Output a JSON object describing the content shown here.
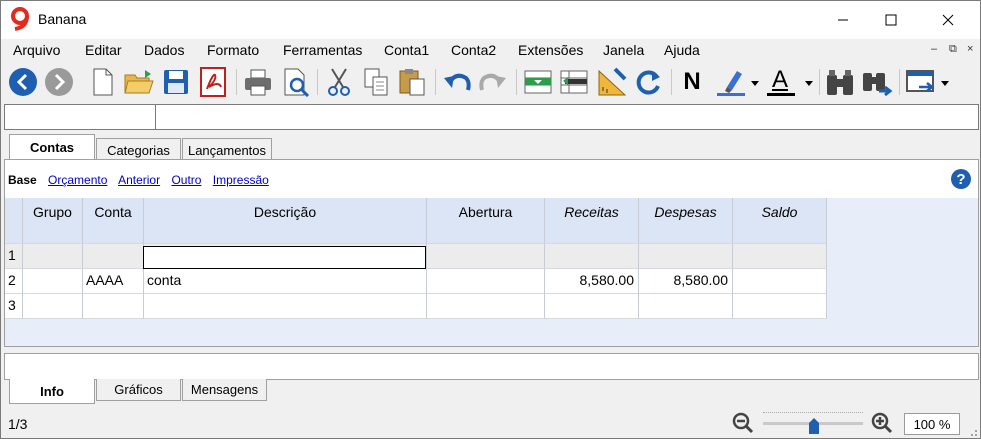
{
  "window": {
    "title": "Banana",
    "logo_glyph": "9",
    "logo_color": "#e32a1c"
  },
  "menu": {
    "items": [
      "Arquivo",
      "Editar",
      "Dados",
      "Formato",
      "Ferramentas",
      "Conta1",
      "Conta2",
      "Extensões",
      "Janela",
      "Ajuda"
    ]
  },
  "toolbar": {
    "icons": [
      "back-icon",
      "forward-icon",
      "new-file-icon",
      "open-folder-icon",
      "save-icon",
      "pdf-icon",
      "print-icon",
      "print-preview-icon",
      "cut-icon",
      "copy-icon",
      "paste-icon",
      "undo-icon",
      "redo-icon",
      "add-row-icon",
      "delete-row-icon",
      "recalculate-ruler-icon",
      "refresh-icon",
      "bold-icon",
      "highlight-icon",
      "font-color-icon",
      "find-icon",
      "find-replace-icon",
      "window-layout-icon"
    ],
    "bold_label": "N",
    "font_color_label": "A",
    "accent_blue": "#1f5fb0",
    "highlight_color": "#3b6fd6",
    "font_color_bar": "#000000"
  },
  "cell_editor": {
    "address": "",
    "content": ""
  },
  "tabs": [
    "Contas",
    "Categorias",
    "Lançamentos"
  ],
  "active_tab": "Contas",
  "views": {
    "current": "Base",
    "links": [
      "Orçamento",
      "Anterior",
      "Outro",
      "Impressão"
    ]
  },
  "table": {
    "columns": [
      "Grupo",
      "Conta",
      "Descrição",
      "Abertura",
      "Receitas",
      "Despesas",
      "Saldo"
    ],
    "italic_columns": [
      "Receitas",
      "Despesas",
      "Saldo"
    ],
    "rows": [
      {
        "n": "1",
        "grupo": "",
        "conta": "",
        "descricao": "",
        "abertura": "",
        "receitas": "",
        "despesas": "",
        "saldo": ""
      },
      {
        "n": "2",
        "grupo": "",
        "conta": "AAAA",
        "descricao": "conta",
        "abertura": "",
        "receitas": "8,580.00",
        "despesas": "8,580.00",
        "saldo": ""
      },
      {
        "n": "3",
        "grupo": "",
        "conta": "",
        "descricao": "",
        "abertura": "",
        "receitas": "",
        "despesas": "",
        "saldo": ""
      }
    ]
  },
  "bottom_tabs": [
    "Info",
    "Gráficos",
    "Mensagens"
  ],
  "active_bottom_tab": "Info",
  "status": {
    "page_indicator": "1/3",
    "zoom_value": "100 %",
    "zoom_level": 1.0
  }
}
